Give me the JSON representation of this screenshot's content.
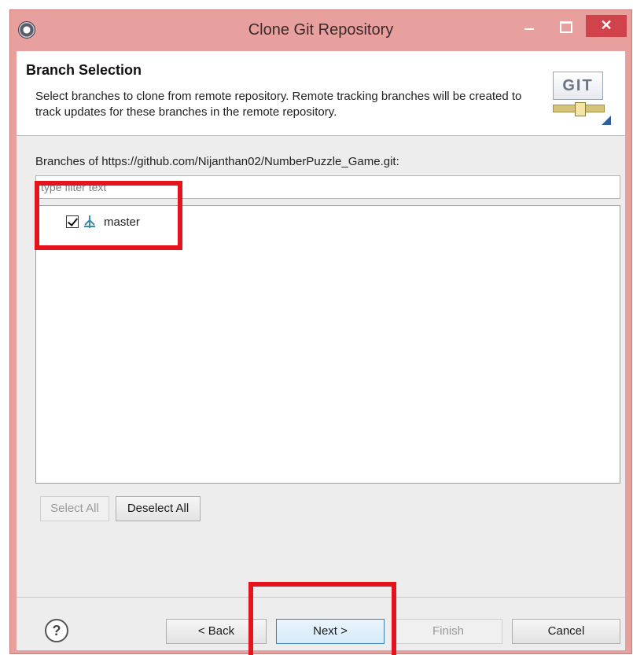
{
  "window": {
    "title": "Clone Git Repository",
    "close_glyph": "✕"
  },
  "header": {
    "title": "Branch Selection",
    "description": "Select branches to clone from remote repository. Remote tracking branches will be created to track updates for these branches in the remote repository.",
    "logo_text": "GIT"
  },
  "branches": {
    "label": "Branches of https://github.com/Nijanthan02/NumberPuzzle_Game.git:",
    "filter_placeholder": "type filter text",
    "items": [
      {
        "name": "master",
        "checked": true
      }
    ]
  },
  "selection_buttons": {
    "select_all": "Select All",
    "deselect_all": "Deselect All"
  },
  "footer": {
    "help_glyph": "?",
    "back": "< Back",
    "next": "Next >",
    "finish": "Finish",
    "cancel": "Cancel"
  },
  "colors": {
    "title_bar": "#e8a09f",
    "close_button": "#d0434b",
    "highlight": "#e3141e",
    "dialog_bg": "#ededed"
  }
}
